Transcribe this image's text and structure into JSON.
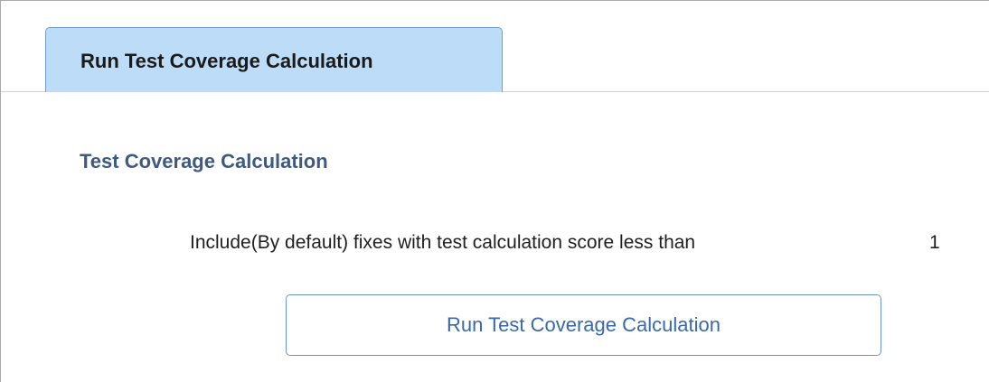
{
  "tabs": [
    {
      "label": "Run Test Coverage Calculation",
      "selected": true
    }
  ],
  "section": {
    "title": "Test Coverage Calculation"
  },
  "field": {
    "label": "Include(By default) fixes with test calculation score less than",
    "value": "1"
  },
  "actions": {
    "run_label": "Run Test Coverage Calculation"
  },
  "colors": {
    "tab_background": "#bcdcf8",
    "tab_border": "#6f9fc9",
    "section_title": "#3f5a82",
    "button_text": "#3a68a8",
    "button_border": "#6d94c0"
  }
}
